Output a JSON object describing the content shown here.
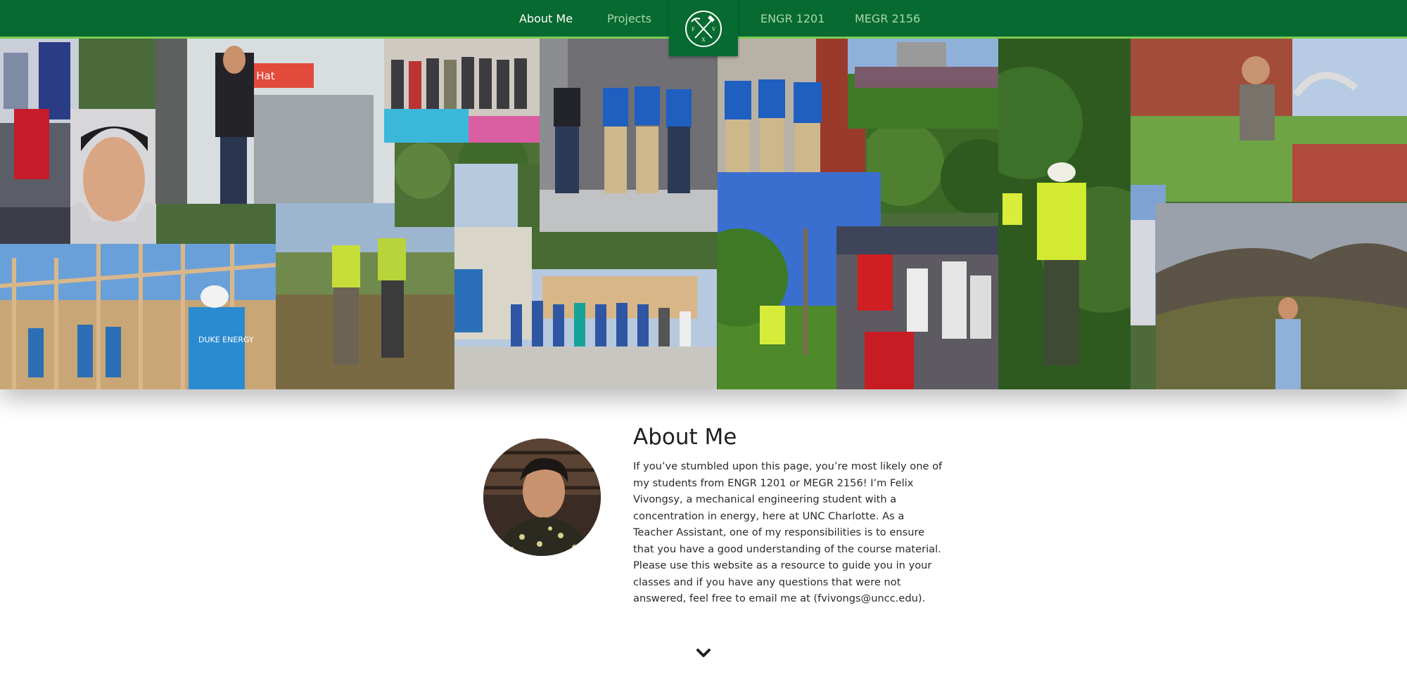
{
  "nav": {
    "about_label": "About Me",
    "projects_label": "Projects",
    "engr_label": "ENGR 1201",
    "megr_label": "MEGR 2156",
    "logo_letters": [
      "F",
      "X",
      "V"
    ]
  },
  "hero": {
    "photo_texts": {
      "redhat_sign": "Red Hat",
      "duke_energy_shirt": "DUKE ENERGY"
    }
  },
  "about": {
    "title": "About Me",
    "body": "If you’ve stumbled upon this page, you’re most likely one of my students from ENGR 1201 or MEGR 2156! I’m Felix Vivongsy, a mechanical engineering student with a concentration in energy, here at UNC Charlotte. As a Teacher Assistant, one of my responsibilities is to ensure that you have a good understanding of the course material. Please use this website as a resource to guide you in your classes and if you have any questions that were not answered, feel free to email me at (fvivongs@uncc.edu)."
  },
  "colors": {
    "nav_bg": "#076a30",
    "nav_accent": "#7ecb55",
    "nav_link_inactive": "#a9d8a9",
    "nav_link_active": "#ffffff"
  },
  "icons": {
    "logo": "pickaxe-hammer-emblem-icon",
    "scroll": "chevron-down-icon"
  }
}
